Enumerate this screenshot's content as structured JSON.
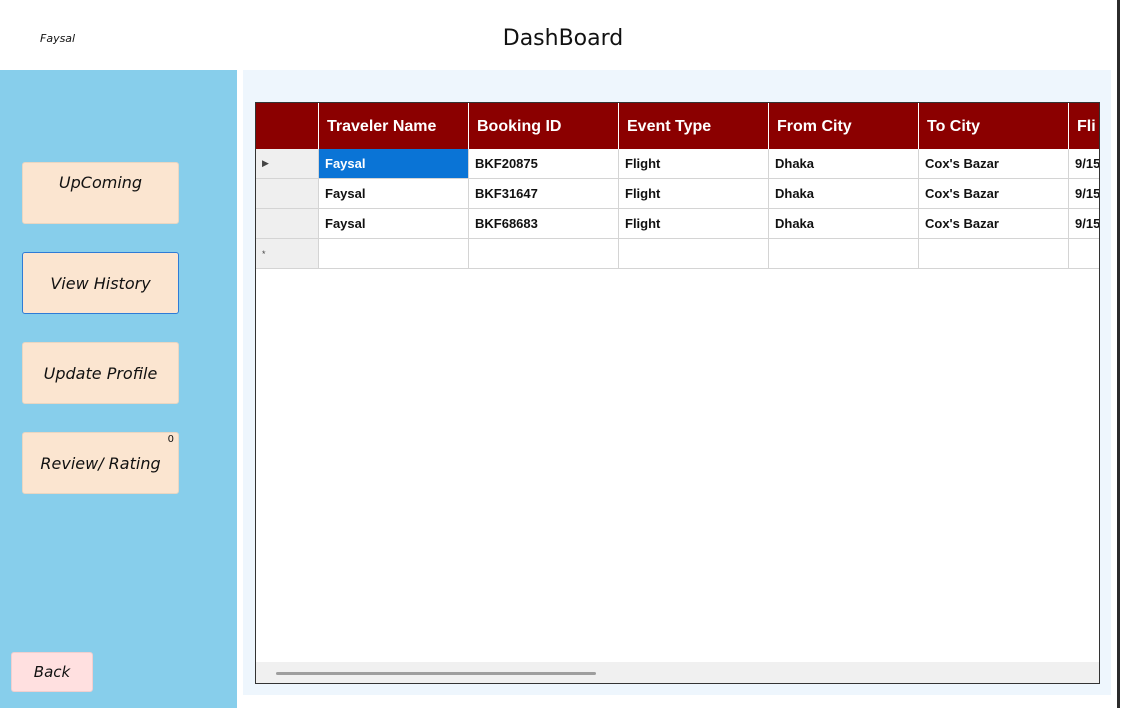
{
  "user": {
    "name": "Faysal"
  },
  "header": {
    "title": "DashBoard"
  },
  "sidebar": {
    "upcoming_label": "UpComing",
    "history_label": "View History",
    "profile_label": "Update Profile",
    "review_label": "Review/ Rating",
    "review_count": "0",
    "back_label": "Back"
  },
  "grid": {
    "columns": [
      "Traveler Name",
      "Booking ID",
      "Event Type",
      "From City",
      "To City",
      "Fli"
    ],
    "rows": [
      [
        "Faysal",
        "BKF20875",
        "Flight",
        "Dhaka",
        "Cox's Bazar",
        "9/15"
      ],
      [
        "Faysal",
        "BKF31647",
        "Flight",
        "Dhaka",
        "Cox's Bazar",
        "9/15"
      ],
      [
        "Faysal",
        "BKF68683",
        "Flight",
        "Dhaka",
        "Cox's Bazar",
        "9/15"
      ]
    ],
    "current_row_marker": "▶",
    "new_row_marker": "*"
  },
  "colors": {
    "sidebar_bg": "#87ceeb",
    "header_bg": "#8b0000",
    "button_bg": "#fbe5d0",
    "back_bg": "#ffe0e0",
    "selection": "#0a74d6"
  }
}
